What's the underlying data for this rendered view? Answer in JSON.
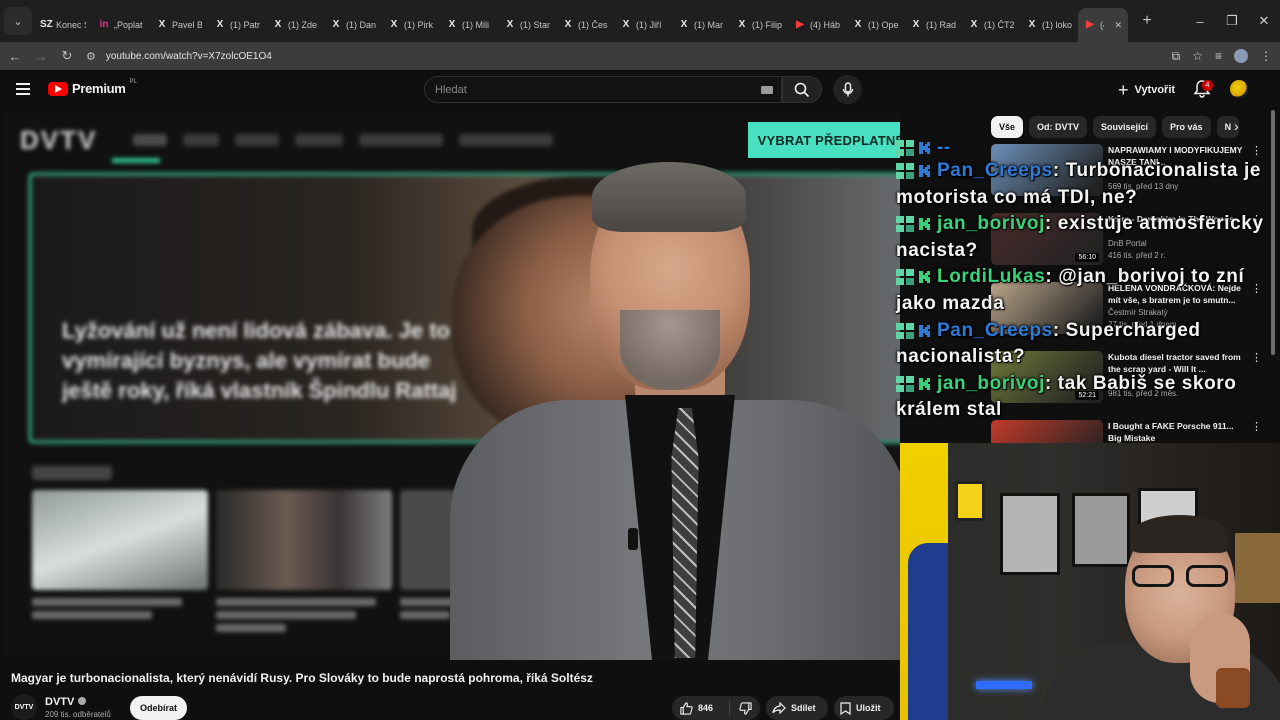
{
  "browser": {
    "tabs": [
      {
        "icon": "SZ",
        "title": "Konec S"
      },
      {
        "icon": "in",
        "title": "„Poplat"
      },
      {
        "icon": "X",
        "title": "Pavel B"
      },
      {
        "icon": "X",
        "title": "(1) Patr"
      },
      {
        "icon": "X",
        "title": "(1) Zde"
      },
      {
        "icon": "X",
        "title": "(1) Dan"
      },
      {
        "icon": "X",
        "title": "(1) Pirk"
      },
      {
        "icon": "X",
        "title": "(1) Mili"
      },
      {
        "icon": "X",
        "title": "(1) Stan"
      },
      {
        "icon": "X",
        "title": "(1) Čes"
      },
      {
        "icon": "X",
        "title": "(1) Jiří"
      },
      {
        "icon": "X",
        "title": "(1) Mar"
      },
      {
        "icon": "X",
        "title": "(1) Filip"
      },
      {
        "icon": "▶",
        "title": "(4) Háb"
      },
      {
        "icon": "X",
        "title": "(1) Ope"
      },
      {
        "icon": "X",
        "title": "(1) Rad"
      },
      {
        "icon": "X",
        "title": "(1) ČT2"
      },
      {
        "icon": "X",
        "title": "(1) loko"
      },
      {
        "icon": "▶",
        "title": "(4)"
      }
    ],
    "url": "youtube.com/watch?v=X7zolcOE1O4"
  },
  "header": {
    "logo_text": "Premium",
    "logo_region": "PL",
    "search_placeholder": "Hledat",
    "create_label": "Vytvořit",
    "notification_count": "4"
  },
  "video": {
    "background_headline": "Lyžování už není lidová zábava. Je to vymírající byznys, ale vymírat bude ještě roky, říká vlastník Špindlu Rattaj",
    "background_logo": "DVTV",
    "cta_label": "VYBRAT PŘEDPLATNÉ",
    "title": "Magyar je turbonacionalista, který nenávidí Rusy. Pro Slováky to bude naprostá pohroma, říká Soltész"
  },
  "channel": {
    "avatar_text": "DVTV",
    "name": "DVTV",
    "subscribers": "209 tis. odběratelů",
    "subscribe_label": "Odebírat"
  },
  "actions": {
    "likes": "846",
    "share_label": "Sdílet",
    "save_label": "Uložit"
  },
  "chips": [
    "Vše",
    "Od: DVTV",
    "Související",
    "Pro vás",
    "N"
  ],
  "suggestions": [
    {
      "title": "NAPRAWIAMY I MODYFIKUJEMY NASZE TANI...",
      "channel": "",
      "meta": "569 tis. před 13 dny",
      "duration": "",
      "color": "#6b8fb8"
    },
    {
      "title": "Kaira - Darkshire In The Woods",
      "channel": "DnB Portal",
      "meta": "416 tis. před 2 r.",
      "duration": "56:10",
      "color": "#4a2b2b"
    },
    {
      "title": "HELENA VONDRÁČKOVÁ: Nejde mít vše, s bratrem je to smutn...",
      "channel": "Čestmír Strakatý",
      "meta": "27 tis. před 1 dnem",
      "duration": "",
      "color": "#b9a48a"
    },
    {
      "title": "Kubota diesel tractor saved from the scrap yard - Will It ...",
      "channel": "",
      "meta": "981 tis. před 2 měs.",
      "duration": "52:21",
      "color": "#6d7a3a"
    },
    {
      "title": "I Bought a FAKE Porsche 911... Big Mistake",
      "channel": "",
      "meta": "",
      "duration": "",
      "color": "#c23a2a"
    }
  ],
  "chat": [
    {
      "user": "--",
      "color": "blue",
      "text": ""
    },
    {
      "user": "Pan_Creeps",
      "color": "blue",
      "text": ": Turbonacionalista je motorista co má TDI, ne?"
    },
    {
      "user": "jan_borivoj",
      "color": "green",
      "text": ": existuje atmosfericky nacista?"
    },
    {
      "user": "LordiLukas",
      "color": "green",
      "text": ": @jan_borivoj to zní jako mazda"
    },
    {
      "user": "Pan_Creeps",
      "color": "blue",
      "text": ": Supercharged nacionalista?"
    },
    {
      "user": "jan_borivoj",
      "color": "green",
      "text": ": tak Babiš se skoro králem stal"
    }
  ],
  "colors": {
    "accent": "#ff0000",
    "cta": "#47e0c0",
    "chat_blue": "#2d7bd6",
    "chat_green": "#39d37b"
  }
}
